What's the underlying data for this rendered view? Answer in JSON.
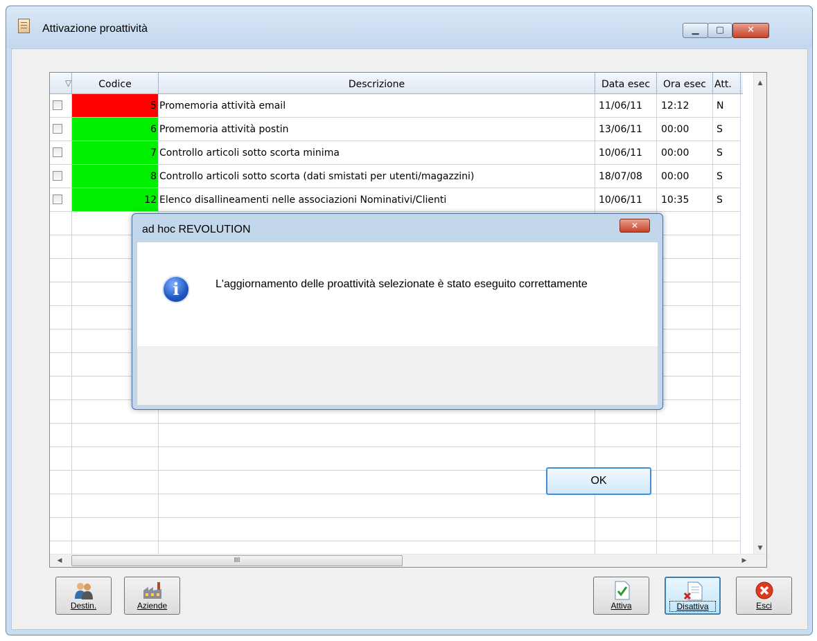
{
  "window": {
    "title": "Attivazione proattività",
    "minimize_glyph": "▁",
    "maximize_glyph": "▢",
    "close_glyph": "✕"
  },
  "grid": {
    "columns": [
      "Codice",
      "Descrizione",
      "Data esec",
      "Ora esec",
      "Att."
    ],
    "sort_index": "1",
    "rows": [
      {
        "codice": "5",
        "descrizione": "Promemoria attività email",
        "data": "11/06/11",
        "ora": "12:12",
        "att": "N",
        "color": "#ff0000"
      },
      {
        "codice": "6",
        "descrizione": "Promemoria attività postin",
        "data": "13/06/11",
        "ora": "00:00",
        "att": "S",
        "color": "#00ee00"
      },
      {
        "codice": "7",
        "descrizione": "Controllo articoli sotto scorta minima",
        "data": "10/06/11",
        "ora": "00:00",
        "att": "S",
        "color": "#00ee00"
      },
      {
        "codice": "8",
        "descrizione": "Controllo articoli sotto scorta (dati smistati per utenti/magazzini)",
        "data": "18/07/08",
        "ora": "00:00",
        "att": "S",
        "color": "#00ee00"
      },
      {
        "codice": "12",
        "descrizione": "Elenco disallineamenti nelle associazioni Nominativi/Clienti",
        "data": "10/06/11",
        "ora": "10:35",
        "att": "S",
        "color": "#00ee00"
      }
    ],
    "hscroll_grip": "III"
  },
  "toolbar": {
    "destin_label": "Destin.",
    "aziende_label": "Aziende",
    "attiva_label": "Attiva",
    "disattiva_label": "Disattiva",
    "esci_label": "Esci"
  },
  "dialog": {
    "title": "ad hoc REVOLUTION",
    "message": "L'aggiornamento delle proattività selezionate è stato eseguito correttamente",
    "ok_label": "OK",
    "close_glyph": "✕",
    "icon": "info-icon"
  }
}
